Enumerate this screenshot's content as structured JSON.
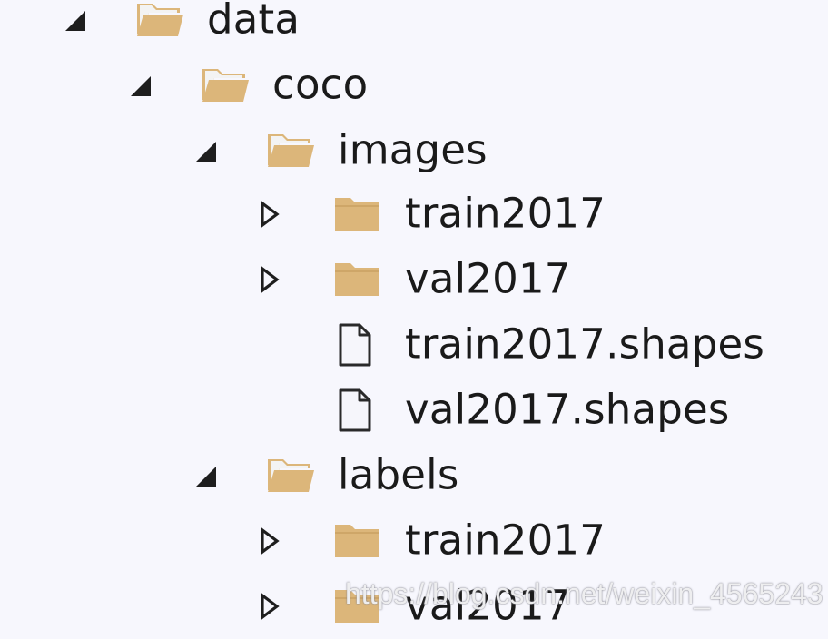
{
  "tree": {
    "data": {
      "label": "data",
      "expanded": true,
      "icon": "folder-open-icon",
      "arrow": "expanded-arrow-icon"
    },
    "coco": {
      "label": "coco",
      "expanded": true,
      "icon": "folder-open-icon",
      "arrow": "expanded-arrow-icon"
    },
    "images": {
      "label": "images",
      "expanded": true,
      "icon": "folder-open-icon",
      "arrow": "expanded-arrow-icon"
    },
    "images_train2017": {
      "label": "train2017",
      "expanded": false,
      "icon": "folder-closed-icon",
      "arrow": "collapsed-arrow-icon"
    },
    "images_val2017": {
      "label": "val2017",
      "expanded": false,
      "icon": "folder-closed-icon",
      "arrow": "collapsed-arrow-icon"
    },
    "train_shapes": {
      "label": "train2017.shapes",
      "icon": "file-icon"
    },
    "val_shapes": {
      "label": "val2017.shapes",
      "icon": "file-icon"
    },
    "labels": {
      "label": "labels",
      "expanded": true,
      "icon": "folder-open-icon",
      "arrow": "expanded-arrow-icon"
    },
    "labels_train2017": {
      "label": "train2017",
      "expanded": false,
      "icon": "folder-closed-icon",
      "arrow": "collapsed-arrow-icon"
    },
    "labels_val2017": {
      "label": "val2017",
      "expanded": false,
      "icon": "folder-closed-icon",
      "arrow": "collapsed-arrow-icon"
    }
  },
  "watermark": "https://blog.csdn.net/weixin_4565243",
  "colors": {
    "background": "#f7f7fd",
    "folder": "#dcb67a",
    "folder_dark": "#c9a063",
    "arrow": "#1e1e1e",
    "text": "#1a1a1a"
  }
}
